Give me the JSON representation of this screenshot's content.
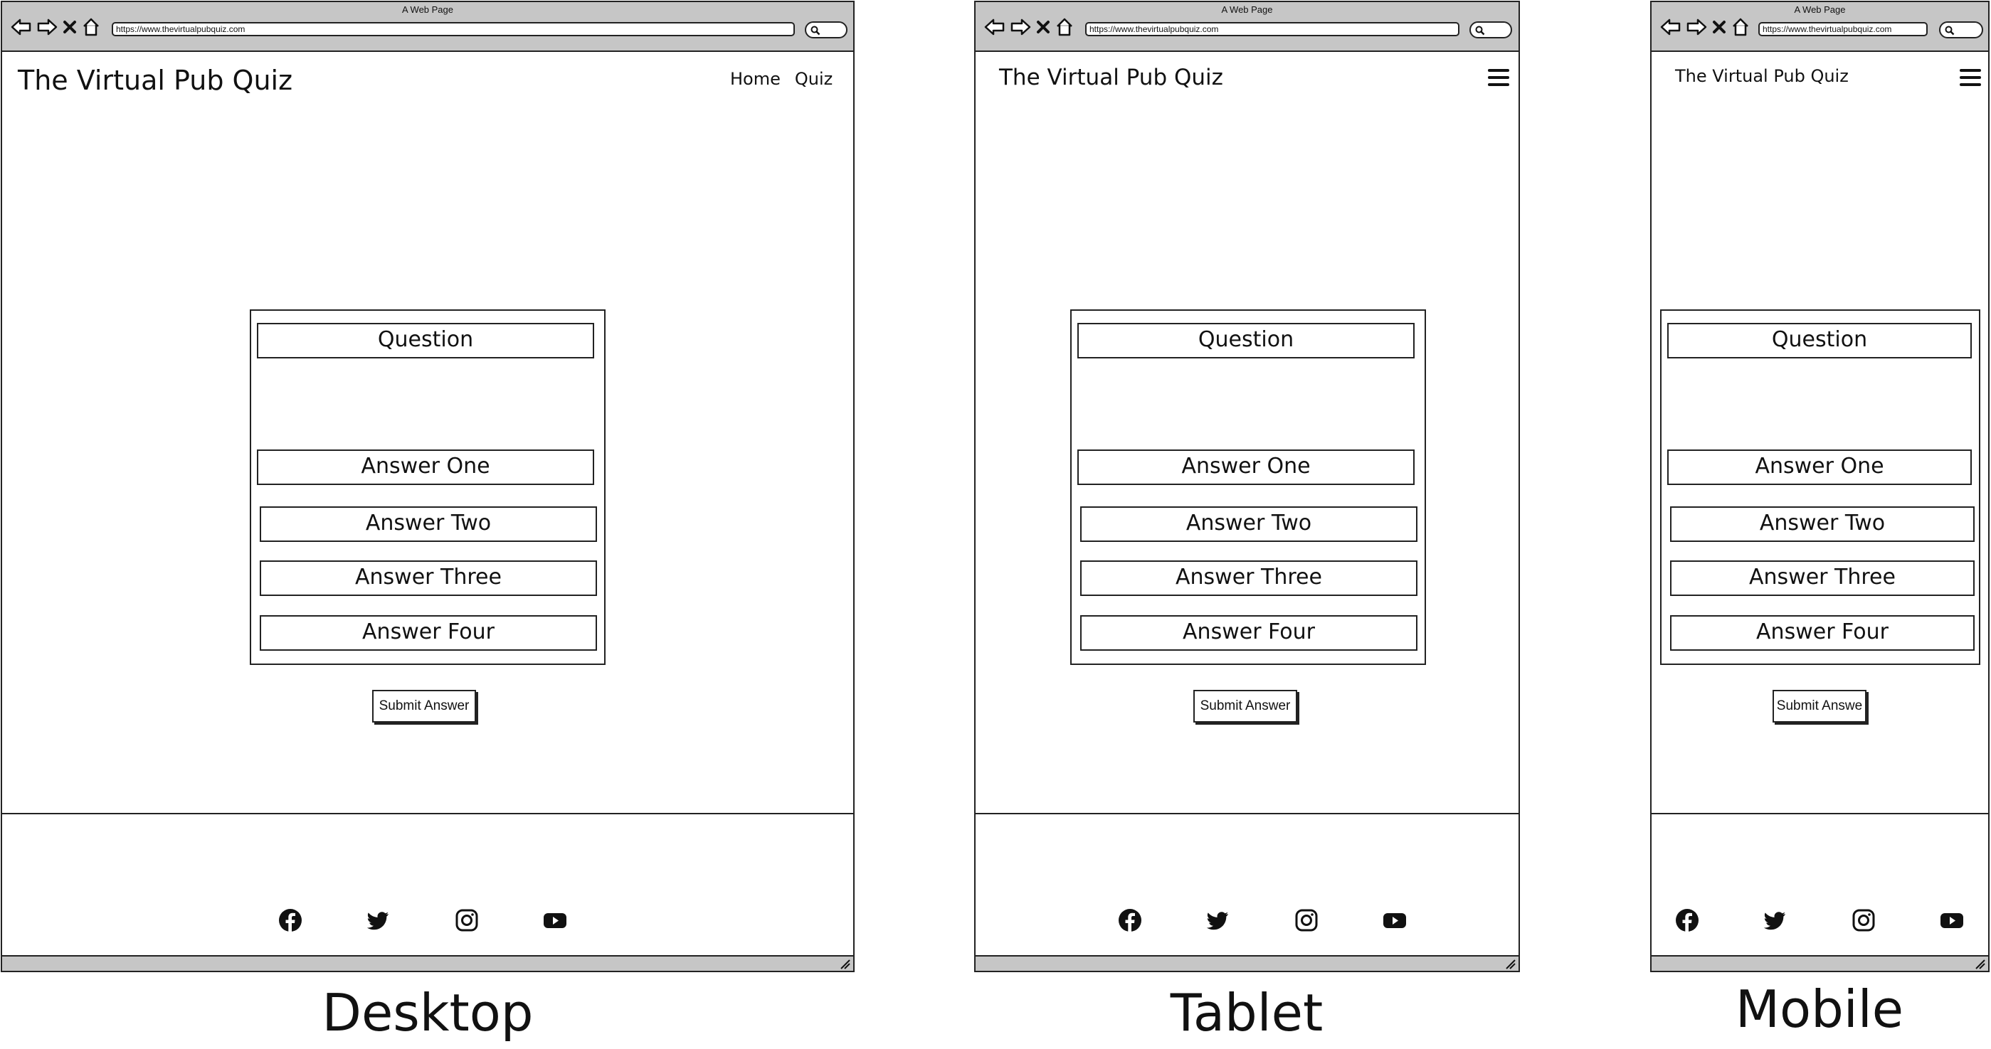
{
  "browser": {
    "window_title": "A Web Page",
    "url": "https://www.thevirtualpubquiz.com"
  },
  "site": {
    "title": "The Virtual Pub Quiz",
    "nav": [
      "Home",
      "Quiz"
    ]
  },
  "quiz": {
    "question": "Question",
    "answers": [
      "Answer One",
      "Answer Two",
      "Answer Three",
      "Answer Four"
    ],
    "submit_label": "Submit Answer",
    "mobile_submit_label": "Submit Answe"
  },
  "footer": {
    "icons": [
      "facebook-icon",
      "twitter-icon",
      "instagram-icon",
      "youtube-icon"
    ]
  },
  "captions": {
    "desktop": "Desktop",
    "tablet": "Tablet",
    "mobile": "Mobile"
  }
}
